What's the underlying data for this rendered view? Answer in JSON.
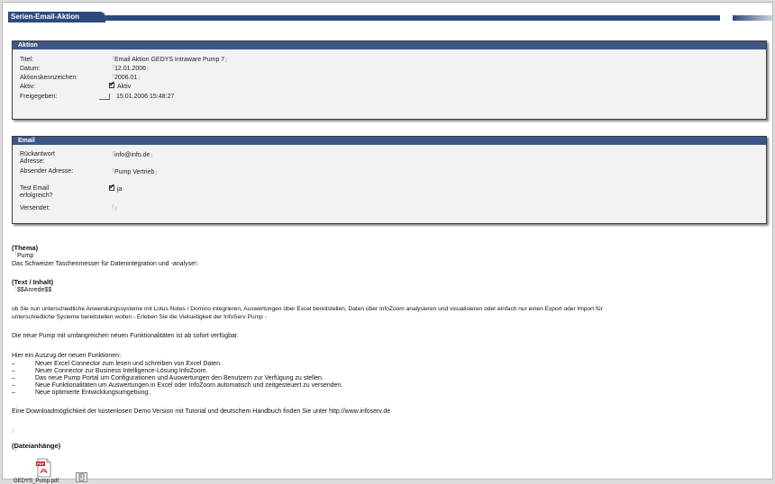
{
  "page": {
    "title": "Serien-Email-Aktion"
  },
  "aktion": {
    "header": "Aktion",
    "titel_label": "Titel:",
    "titel_value": "Email Aktion GEDYS Intraware Pump 7",
    "datum_label": "Datum:",
    "datum_value": "12.01.2006",
    "kennzeichen_label": "Aktionskennzeichen:",
    "kennzeichen_value": "2006.01",
    "aktiv_label": "Aktiv:",
    "aktiv_value": "Aktiv",
    "freigegeben_label": "Freigegeben:",
    "freigegeben_value": "15.01.2006 15:48:27"
  },
  "email": {
    "header": "Email",
    "rueckantwort_label": "Rückantwort Adresse:",
    "rueckantwort_value": "info@info.de",
    "absender_label": "Absender Adresse:",
    "absender_value": "Pump Vertrieb",
    "test_label": "Test Email erfolgreich?",
    "test_value": "ja",
    "versendet_label": "Versendet:",
    "versendet_value": ""
  },
  "thema": {
    "header": "(Thema)",
    "value": "Pump",
    "subtitle": "Das Schweizer Taschenmesser für Datenintegration und -analyse!"
  },
  "inhalt": {
    "header": "(Text / Inhalt)",
    "anrede": "$$Anrede$$",
    "para1_line1": "ob Sie nun unterschiedliche Anwendungssysteme mit Lotus Notes / Domino integrieren, Auswertungen über Excel bereitstellen, Daten über InfoZoom analysieren und visualisieren oder einfach nur einen Export oder Import für",
    "para1_line2": "unterschiedliche Systeme bereitstellen wollen - Erleben Sie die Vielseitigkeit der InfoServ Pump -",
    "para2": "Die neue Pump mit umfangreichen neuen Funktionalitäten ist ab sofort verfügbar.",
    "list_intro": "Hier ein Auszug der neuen Funktionen:",
    "list": [
      "Neuer Excel Connector zum lesen und schreiben von Excel Daten.",
      "Neuer Connector zur Business Intelligence-Lösung InfoZoom.",
      "Das neue Pump Portal um Configurationen und Auswertungen den Benutzern zur Verfügung zu stellen.",
      "Neue Funktionalitäten um Auswertungen in Excel oder InfoZoom automatisch und zeitgesteuert zu versenden.",
      "Neue optimierte Entwicklungsumgebung."
    ],
    "list_dash": "–",
    "para3": "Eine Downloadmöglichkeit der kostenlosen Demo Version mit Tutorial und deutschem Handbuch finden Sie unter http://www.infoserv.de"
  },
  "anhaenge": {
    "header": "(Dateianhänge)",
    "file_name": "GEDYS_Pump.pdf"
  },
  "colors": {
    "header_blue": "#3c5787",
    "title_blue": "#2d4a7d",
    "pdf_red": "#c8202a"
  },
  "icons": {
    "attachment": "pdf-file-icon",
    "attach_button": "paperclip-icon"
  }
}
